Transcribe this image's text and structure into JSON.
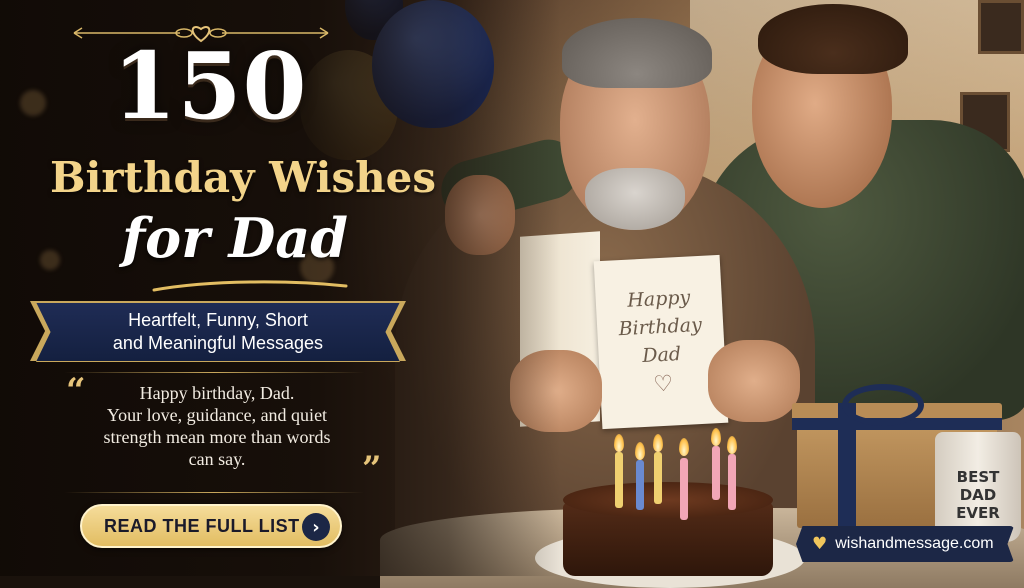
{
  "headline": {
    "number": "150",
    "line2": "Birthday Wishes",
    "line3": "for Dad"
  },
  "subtitle_banner": {
    "line1": "Heartfelt, Funny, Short",
    "line2": "and Meaningful Messages"
  },
  "quote": {
    "lines": [
      "Happy birthday, Dad.",
      "Your love, guidance, and quiet",
      "strength mean more than words",
      "can say."
    ],
    "open_mark": "“",
    "close_mark": "”"
  },
  "cta": {
    "label": "READ THE FULL LIST",
    "icon": "chevron-right-icon"
  },
  "card": {
    "line1": "Happy",
    "line2": "Birthday",
    "line3": "Dad",
    "heart": "♡"
  },
  "mug": {
    "line1": "BEST",
    "line2": "DAD",
    "line3": "EVER"
  },
  "site_badge": {
    "icon": "heart-icon",
    "text": "wishandmessage.com"
  },
  "colors": {
    "gold": "#f3d48a",
    "navy": "#1c2746",
    "cta_gold": "#e2bd62"
  }
}
